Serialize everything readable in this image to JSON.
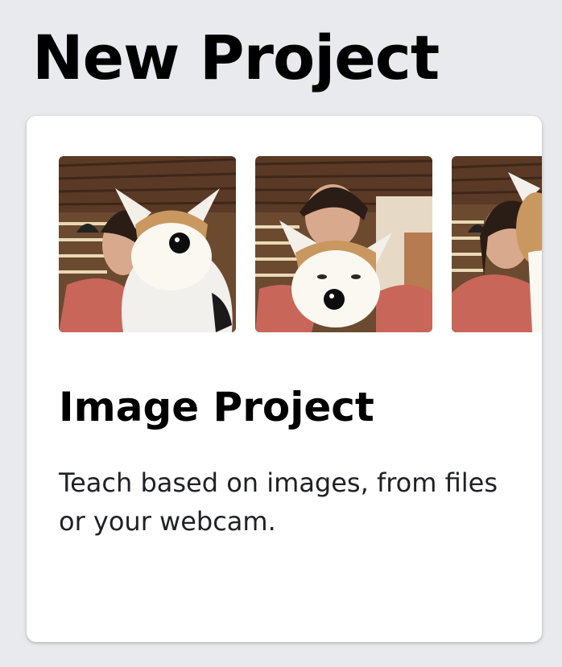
{
  "page": {
    "title": "New Project"
  },
  "card": {
    "title": "Image Project",
    "description": "Teach based on images, from files or your webcam.",
    "thumbnails": [
      {
        "subject": "person-with-plush-corgi"
      },
      {
        "subject": "person-with-plush-corgi"
      },
      {
        "subject": "person-with-plush-corgi"
      }
    ]
  },
  "colors": {
    "background": "#e8eaed",
    "card": "#ffffff",
    "text": "#000000"
  }
}
